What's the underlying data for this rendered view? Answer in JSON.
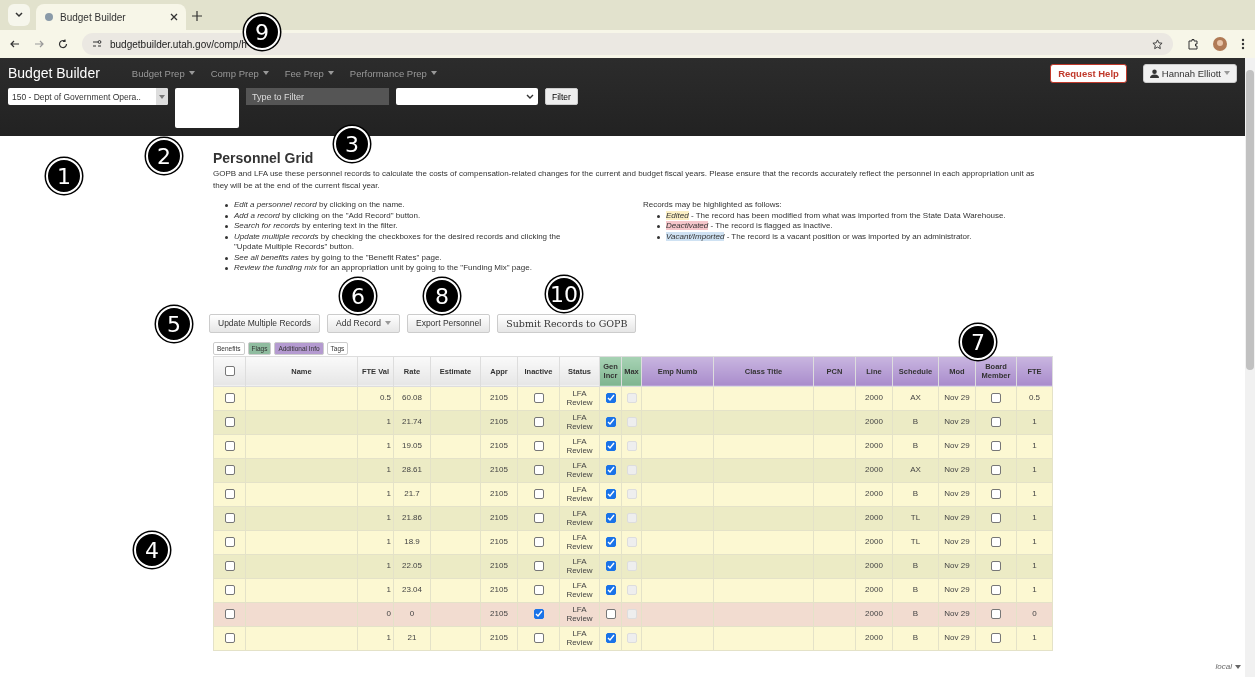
{
  "browser": {
    "tab_title": "Budget Builder",
    "url": "budgetbuilder.utah.gov/comp/h"
  },
  "navbar": {
    "brand": "Budget Builder",
    "menus": [
      "Budget Prep",
      "Comp Prep",
      "Fee Prep",
      "Performance Prep"
    ],
    "help_button": "Request Help",
    "user_button": "Hannah Elliott"
  },
  "filters": {
    "department": "150 - Dept of Government Opera..",
    "filter_placeholder": "Type to Filter",
    "filter_button": "Filter"
  },
  "page": {
    "title": "Personnel Grid",
    "intro": "GOPB and LFA use these personnel records to calculate the costs of compensation-related changes for the current and budget fiscal years. Please ensure that the records accurately reflect the personnel in each appropriation unit as they will be at the end of the current fiscal year.",
    "tips": [
      "*Edit a personnel record* by clicking on the name.",
      "*Add a record* by clicking on the \"Add Record\" button.",
      "*Search for records* by entering text in the filter.",
      "*Update multiple records* by checking the checkboxes for the desired records and clicking the \"Update Multiple Records\" button.",
      "*See all benefits rates* by going to the \"Benefit Rates\" page.",
      "*Review the funding mix* for an appropriation unit by going to the \"Funding Mix\" page."
    ],
    "legend_title": "Records may be highlighted as follows:",
    "legend": [
      {
        "kind": "edited",
        "term": "Edited",
        "text": " - The record has been modified from what was imported from the State Data Warehouse."
      },
      {
        "kind": "deactivated",
        "term": "Deactivated",
        "text": " - The record is flagged as inactive."
      },
      {
        "kind": "vacant",
        "term": "Vacant/Imported",
        "text": " - The record is a vacant position or was imported by an administrator."
      }
    ]
  },
  "actions": [
    {
      "label": "Update Multiple Records",
      "kind": "plain"
    },
    {
      "label": "Add Record",
      "kind": "dropdown"
    },
    {
      "label": "Export Personnel",
      "kind": "plain"
    },
    {
      "label": "Submit Records to GOPB",
      "kind": "serif"
    }
  ],
  "column_groups": [
    {
      "label": "Benefits",
      "kind": "benefits"
    },
    {
      "label": "Flags",
      "kind": "flags"
    },
    {
      "label": "Additional Info",
      "kind": "additional"
    },
    {
      "label": "Tags",
      "kind": "tags"
    }
  ],
  "table": {
    "select_all_checked": false,
    "columns": [
      {
        "label": "Name",
        "kind": "benefits"
      },
      {
        "label": "FTE Val",
        "kind": "benefits"
      },
      {
        "label": "Rate",
        "kind": "benefits"
      },
      {
        "label": "Estimate",
        "kind": "benefits"
      },
      {
        "label": "Appr",
        "kind": "benefits"
      },
      {
        "label": "Inactive",
        "kind": "benefits"
      },
      {
        "label": "Status",
        "kind": "benefits"
      },
      {
        "label": "Gen Incr",
        "kind": "flags"
      },
      {
        "label": "Max",
        "kind": "flags"
      },
      {
        "label": "Emp Numb",
        "kind": "additional"
      },
      {
        "label": "Class Title",
        "kind": "additional"
      },
      {
        "label": "PCN",
        "kind": "additional"
      },
      {
        "label": "Line",
        "kind": "additional"
      },
      {
        "label": "Schedule",
        "kind": "additional"
      },
      {
        "label": "Mod",
        "kind": "additional"
      },
      {
        "label": "Board Member",
        "kind": "additional"
      },
      {
        "label": "FTE",
        "kind": "additional"
      }
    ],
    "rows": [
      {
        "kind": "edited",
        "checked": false,
        "fte_val": "0.5",
        "rate": "60.08",
        "appr": "2105",
        "inactive": false,
        "status": "LFA Review",
        "gen_incr": true,
        "max": false,
        "line": "2000",
        "schedule": "AX",
        "mod": "Nov 29",
        "board_member": false,
        "fte": "0.5"
      },
      {
        "kind": "edited",
        "checked": false,
        "fte_val": "1",
        "rate": "21.74",
        "appr": "2105",
        "inactive": false,
        "status": "LFA Review",
        "gen_incr": true,
        "max": false,
        "line": "2000",
        "schedule": "B",
        "mod": "Nov 29",
        "board_member": false,
        "fte": "1"
      },
      {
        "kind": "edited",
        "checked": false,
        "fte_val": "1",
        "rate": "19.05",
        "appr": "2105",
        "inactive": false,
        "status": "LFA Review",
        "gen_incr": true,
        "max": false,
        "line": "2000",
        "schedule": "B",
        "mod": "Nov 29",
        "board_member": false,
        "fte": "1"
      },
      {
        "kind": "edited",
        "checked": false,
        "fte_val": "1",
        "rate": "28.61",
        "appr": "2105",
        "inactive": false,
        "status": "LFA Review",
        "gen_incr": true,
        "max": false,
        "line": "2000",
        "schedule": "AX",
        "mod": "Nov 29",
        "board_member": false,
        "fte": "1"
      },
      {
        "kind": "edited",
        "checked": false,
        "fte_val": "1",
        "rate": "21.7",
        "appr": "2105",
        "inactive": false,
        "status": "LFA Review",
        "gen_incr": true,
        "max": false,
        "line": "2000",
        "schedule": "B",
        "mod": "Nov 29",
        "board_member": false,
        "fte": "1"
      },
      {
        "kind": "edited",
        "checked": false,
        "fte_val": "1",
        "rate": "21.86",
        "appr": "2105",
        "inactive": false,
        "status": "LFA Review",
        "gen_incr": true,
        "max": false,
        "line": "2000",
        "schedule": "TL",
        "mod": "Nov 29",
        "board_member": false,
        "fte": "1"
      },
      {
        "kind": "edited",
        "checked": false,
        "fte_val": "1",
        "rate": "18.9",
        "appr": "2105",
        "inactive": false,
        "status": "LFA Review",
        "gen_incr": true,
        "max": false,
        "line": "2000",
        "schedule": "TL",
        "mod": "Nov 29",
        "board_member": false,
        "fte": "1"
      },
      {
        "kind": "edited",
        "checked": false,
        "fte_val": "1",
        "rate": "22.05",
        "appr": "2105",
        "inactive": false,
        "status": "LFA Review",
        "gen_incr": true,
        "max": false,
        "line": "2000",
        "schedule": "B",
        "mod": "Nov 29",
        "board_member": false,
        "fte": "1"
      },
      {
        "kind": "edited",
        "checked": false,
        "fte_val": "1",
        "rate": "23.04",
        "appr": "2105",
        "inactive": false,
        "status": "LFA Review",
        "gen_incr": true,
        "max": false,
        "line": "2000",
        "schedule": "B",
        "mod": "Nov 29",
        "board_member": false,
        "fte": "1"
      },
      {
        "kind": "deactivated",
        "checked": false,
        "fte_val": "0",
        "rate": "0",
        "appr": "2105",
        "inactive": true,
        "status": "LFA Review",
        "gen_incr": false,
        "max": false,
        "line": "2000",
        "schedule": "B",
        "mod": "Nov 29",
        "board_member": false,
        "fte": "0"
      },
      {
        "kind": "edited",
        "checked": false,
        "fte_val": "1",
        "rate": "21",
        "appr": "2105",
        "inactive": false,
        "status": "LFA Review",
        "gen_incr": true,
        "max": false,
        "line": "2000",
        "schedule": "B",
        "mod": "Nov 29",
        "board_member": false,
        "fte": "1"
      }
    ]
  },
  "environment_label": "local",
  "callouts": [
    "1",
    "2",
    "3",
    "4",
    "5",
    "6",
    "7",
    "8",
    "9",
    "10"
  ]
}
